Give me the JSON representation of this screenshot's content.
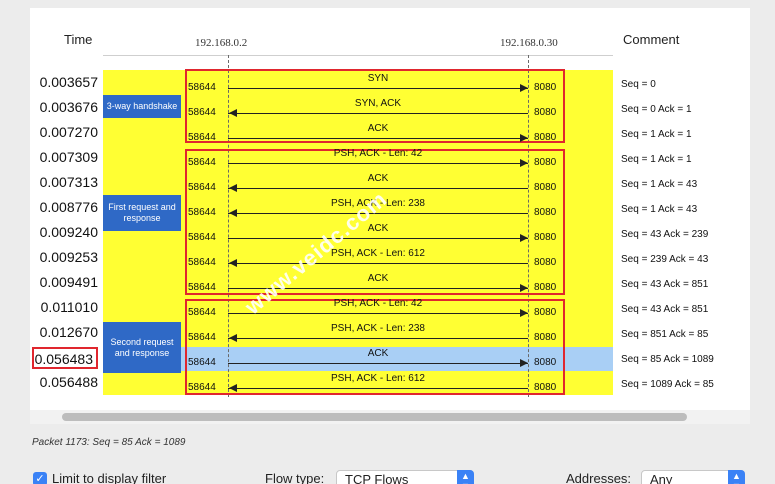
{
  "headers": {
    "time": "Time",
    "comment": "Comment",
    "address_left": "192.168.0.2",
    "address_right": "192.168.0.30"
  },
  "phases": [
    {
      "label": "3-way handshake"
    },
    {
      "label": "First request and response"
    },
    {
      "label": "Second request and response"
    }
  ],
  "rows": [
    {
      "time": "0.003657",
      "src_port": "58644",
      "dst_port": "8080",
      "label": "SYN",
      "direction": "right",
      "comment": "Seq = 0"
    },
    {
      "time": "0.003676",
      "src_port": "58644",
      "dst_port": "8080",
      "label": "SYN, ACK",
      "direction": "left",
      "comment": "Seq = 0 Ack = 1"
    },
    {
      "time": "0.007270",
      "src_port": "58644",
      "dst_port": "8080",
      "label": "ACK",
      "direction": "right",
      "comment": "Seq = 1 Ack = 1"
    },
    {
      "time": "0.007309",
      "src_port": "58644",
      "dst_port": "8080",
      "label": "PSH, ACK - Len: 42",
      "direction": "right",
      "comment": "Seq = 1 Ack = 1"
    },
    {
      "time": "0.007313",
      "src_port": "58644",
      "dst_port": "8080",
      "label": "ACK",
      "direction": "left",
      "comment": "Seq = 1 Ack = 43"
    },
    {
      "time": "0.008776",
      "src_port": "58644",
      "dst_port": "8080",
      "label": "PSH, ACK - Len: 238",
      "direction": "left",
      "comment": "Seq = 1 Ack = 43"
    },
    {
      "time": "0.009240",
      "src_port": "58644",
      "dst_port": "8080",
      "label": "ACK",
      "direction": "right",
      "comment": "Seq = 43 Ack = 239"
    },
    {
      "time": "0.009253",
      "src_port": "58644",
      "dst_port": "8080",
      "label": "PSH, ACK - Len: 612",
      "direction": "left",
      "comment": "Seq = 239 Ack = 43"
    },
    {
      "time": "0.009491",
      "src_port": "58644",
      "dst_port": "8080",
      "label": "ACK",
      "direction": "right",
      "comment": "Seq = 43 Ack = 851"
    },
    {
      "time": "0.011010",
      "src_port": "58644",
      "dst_port": "8080",
      "label": "PSH, ACK - Len: 42",
      "direction": "right",
      "comment": "Seq = 43 Ack = 851"
    },
    {
      "time": "0.012670",
      "src_port": "58644",
      "dst_port": "8080",
      "label": "PSH, ACK - Len: 238",
      "direction": "left",
      "comment": "Seq = 851 Ack = 85"
    },
    {
      "time": "0.056483",
      "src_port": "58644",
      "dst_port": "8080",
      "label": "ACK",
      "direction": "right",
      "comment": "Seq = 85 Ack = 1089",
      "selected": true
    },
    {
      "time": "0.056488",
      "src_port": "58644",
      "dst_port": "8080",
      "label": "PSH, ACK - Len: 612",
      "direction": "left",
      "comment": "Seq = 1089 Ack = 85"
    }
  ],
  "status": {
    "text": "Packet 1173: Seq = 85 Ack = 1089"
  },
  "controls": {
    "limit_label": "Limit to display filter",
    "limit_checked": true,
    "flow_type_label": "Flow type:",
    "flow_type_value": "TCP Flows",
    "addresses_label": "Addresses:",
    "addresses_value": "Any"
  },
  "watermark": "www.veidc.com",
  "colors": {
    "background_highlight": "#ffff33",
    "selected_row": "#a9cff5",
    "phase_box": "#2f69c6",
    "red_outline": "#e0262e",
    "accent": "#3a82f6"
  }
}
